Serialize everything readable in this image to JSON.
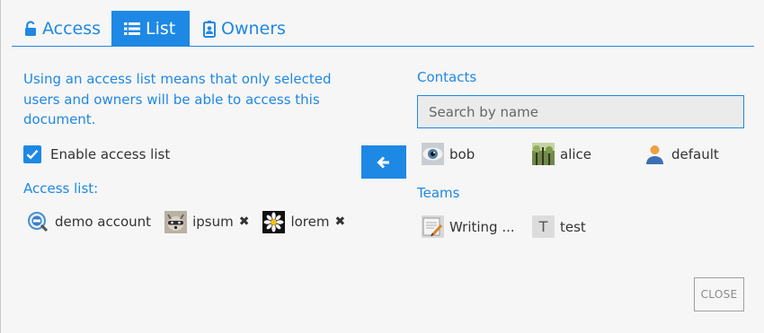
{
  "tabs": [
    {
      "label": "Access",
      "icon": "unlock-icon"
    },
    {
      "label": "List",
      "icon": "list-icon"
    },
    {
      "label": "Owners",
      "icon": "badge-icon"
    }
  ],
  "active_tab": "List",
  "intro_text": "Using an access list means that only selected users and owners will be able to access this document.",
  "enable_access_list": {
    "label": "Enable access list",
    "checked": true
  },
  "access_list": {
    "label": "Access list:",
    "members": [
      {
        "name": "demo account",
        "removable": false,
        "avatar": "magnifier-avatar"
      },
      {
        "name": "ipsum",
        "removable": true,
        "avatar": "raccoon-avatar"
      },
      {
        "name": "lorem",
        "removable": true,
        "avatar": "daisy-avatar"
      }
    ],
    "remove_glyph": "✖"
  },
  "add_button_icon": "arrow-left-icon",
  "contacts": {
    "label": "Contacts",
    "search_placeholder": "Search by name",
    "items": [
      {
        "name": "bob",
        "avatar": "eye-avatar"
      },
      {
        "name": "alice",
        "avatar": "forest-avatar"
      },
      {
        "name": "default",
        "avatar": "person-avatar"
      }
    ]
  },
  "teams": {
    "label": "Teams",
    "items": [
      {
        "name": "Writing ...",
        "avatar": "writing-avatar"
      },
      {
        "name": "test",
        "avatar": "letter-avatar",
        "initial": "T"
      }
    ]
  },
  "close_label": "CLOSE",
  "colors": {
    "accent": "#1e88e5",
    "background": "#f6f6f6",
    "text": "#333333"
  }
}
